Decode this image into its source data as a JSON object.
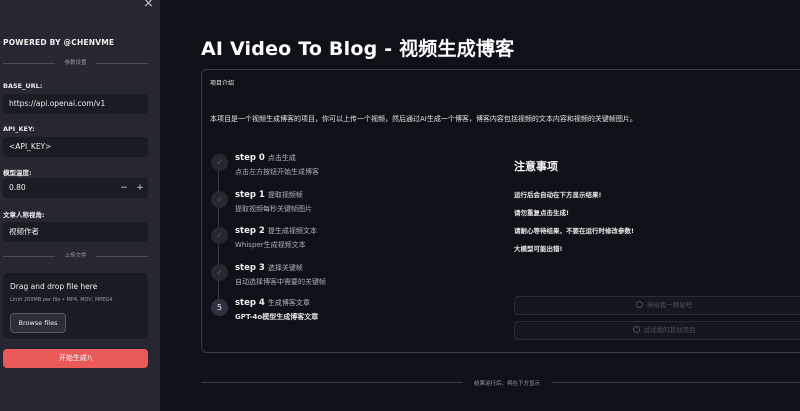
{
  "sidebar": {
    "close_icon": "×",
    "powered_by": "POWERED BY @CHENVME",
    "section_params": "参数设置",
    "base_url_label": "BASE_URL:",
    "base_url_value": "https://api.openai.com/v1",
    "api_key_label": "API_KEY:",
    "api_key_value": "<API_KEY>",
    "temperature_label": "模型温度:",
    "temperature_value": "0.80",
    "minus": "−",
    "plus": "+",
    "perspective_label": "文章人称视角:",
    "perspective_value": "视频作者",
    "section_upload": "上传文件",
    "drag_drop": "Drag and drop file here",
    "limit_text": "Limit 200MB per file • MP4, MOV, MPEG4",
    "browse_label": "Browse files",
    "generate_label": "开始生成!\\"
  },
  "main": {
    "title": "AI Video To Blog - 视频生成博客",
    "card_header": "项目介绍",
    "intro": "本项目是一个视频生成博客的项目，你可以上传一个视频，然后通过AI生成一个博客，博客内容包括视频的文本内容和视频的关键帧图片。",
    "steps": [
      {
        "name": "step 0",
        "sub": "点击生成",
        "desc": "点击左方按钮开始生成博客",
        "marker": "✓"
      },
      {
        "name": "step 1",
        "sub": "提取视频帧",
        "desc": "提取视频每秒关键帧图片",
        "marker": "✓"
      },
      {
        "name": "step 2",
        "sub": "提生成视频文本",
        "desc": "Whisper生成视频文本",
        "marker": "✓"
      },
      {
        "name": "step 3",
        "sub": "选择关键帧",
        "desc": "自动选择博客中需要的关键帧",
        "marker": "✓"
      },
      {
        "name": "step 4",
        "sub": "生成博客文章",
        "desc": "GPT-4o模型生成博客文章",
        "marker": "5"
      }
    ],
    "notice_title": "注意事项",
    "notices": [
      "运行后会自动在下方显示结果!",
      "请勿重复点击生成!",
      "请耐心等待结果，不要在运行时修改参数!",
      "大模型可能出错!"
    ],
    "github_star": "来给我一颗星吧",
    "github_issue": "试试我的其他项目",
    "results_label": "结果运行后，将在下方显示"
  },
  "colors": {
    "background": "#0e1117",
    "sidebar": "#262730",
    "primary": "#ea5a5a"
  }
}
